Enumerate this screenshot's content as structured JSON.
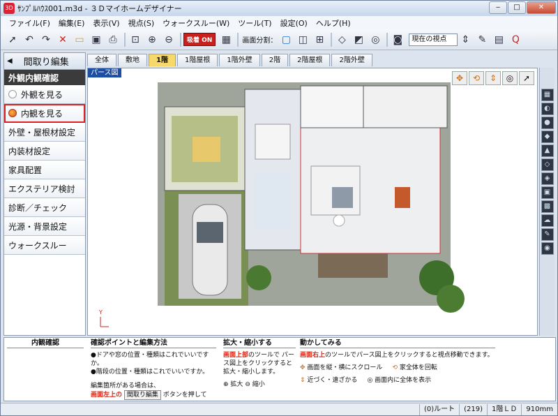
{
  "window": {
    "title": "ｻﾝﾌﾟﾙﾊｳｽ001.m3d - ３Ｄマイホームデザイナー",
    "app_icon": "3D"
  },
  "menubar": [
    "ファイル(F)",
    "編集(E)",
    "表示(V)",
    "視点(S)",
    "ウォークスルー(W)",
    "ツール(T)",
    "設定(O)",
    "ヘルプ(H)"
  ],
  "toolbar": {
    "snap_label": "吸着 ON",
    "split_label": "画面分割：",
    "viewpoint_value": "現在の視点"
  },
  "sidebar": {
    "header": "間取り編集",
    "section": "外観内観確認",
    "items": [
      "外観を見る",
      "内観を見る",
      "外壁・屋根材設定",
      "内装材設定",
      "家具配置",
      "エクステリア検討",
      "診断／チェック",
      "光源・背景設定",
      "ウォークスルー"
    ]
  },
  "tabs": [
    "全体",
    "敷地",
    "1階",
    "1階屋根",
    "1階外壁",
    "2階",
    "2階屋根",
    "2階外壁"
  ],
  "view": {
    "label": "パース図"
  },
  "bottom": {
    "col1_title": "内観確認",
    "col2_title": "確認ポイントと編集方法",
    "col2_lines": [
      "●ドアや窓の位置・種類はこれでいいですか。",
      "●階段の位置・種類はこれでいいですか。"
    ],
    "col2_edit": "編集箇所がある場合は、",
    "col2_red": "画面左上の",
    "col2_btn": "間取り編集",
    "col2_tail": "ボタンを押して",
    "col3_title": "拡大・縮小する",
    "col3_red": "画面上部",
    "col3_text": "のツールで パース図上をクリックすると 拡大・縮小します。",
    "col3_zoomin": "拡大",
    "col3_zoomout": "縮小",
    "col4_title": "動かしてみる",
    "col4_red": "画面右上",
    "col4_text": "のツールでパース図上をクリックすると視点移動できます。",
    "col4_a": "画面を縦・横にスクロール",
    "col4_b": "家全体を回転",
    "col4_c": "近づく・遠ざかる",
    "col4_d": "画面内に全体を表示"
  },
  "status": {
    "route": "(0)ルート",
    "count": "(219)",
    "floor": "1階ＬＤ",
    "size": "910mm"
  }
}
